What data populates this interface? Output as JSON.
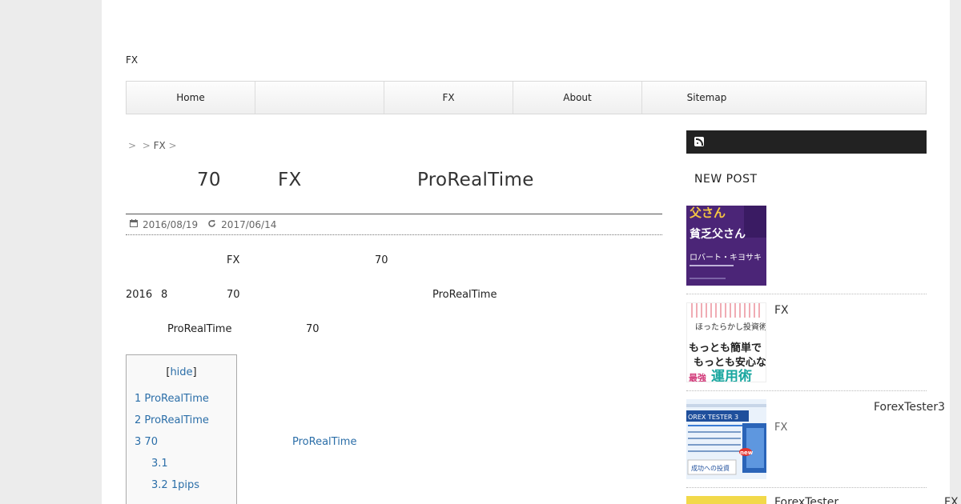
{
  "site": {
    "title": "FX"
  },
  "nav": {
    "items": [
      "Home",
      "",
      "FX",
      "About",
      "Sitemap"
    ]
  },
  "breadcrumb": {
    "sep1": ">",
    "sep2": ">",
    "crumb": "FX",
    "sep3": ">"
  },
  "post": {
    "title_parts": [
      "70",
      "FX",
      "ProRealTime"
    ],
    "published": "2016/08/19",
    "updated": "2017/06/14",
    "p1": [
      "FX",
      "70"
    ],
    "p2": [
      "2016",
      "8",
      "70",
      "ProRealTime"
    ],
    "p3": [
      "ProRealTime",
      "70"
    ]
  },
  "toc": {
    "hide_open": "[",
    "hide": "hide",
    "hide_close": "]",
    "items": [
      {
        "num": "1",
        "text": "ProRealTime"
      },
      {
        "num": "2",
        "text": "ProRealTime"
      },
      {
        "num": "3",
        "text": "70",
        "extra": "ProRealTime"
      },
      {
        "num": "3.1",
        "text": ""
      },
      {
        "num": "3.2",
        "text": "1pips"
      }
    ]
  },
  "sidebar": {
    "heading": "NEW POST",
    "posts": [
      {
        "title": "",
        "sub": ""
      },
      {
        "title": "FX",
        "sub": ""
      },
      {
        "title": "ForexTester3",
        "sub": "FX"
      },
      {
        "title": "ForexTester",
        "sub": "FX"
      }
    ],
    "thumb1_text": [
      "父さん",
      "貧乏父さん",
      "ロバート・キヨサキ"
    ],
    "thumb2_text": [
      "ほったらかし投資術",
      "もっとも簡単で",
      "もっとも安心な",
      "最強",
      "運用術"
    ],
    "thumb3_text": [
      "OREX TESTER 3",
      "new",
      "成功への投資"
    ]
  },
  "colors": {
    "link": "#2b6ea8",
    "sidebar_bar": "#222222"
  }
}
